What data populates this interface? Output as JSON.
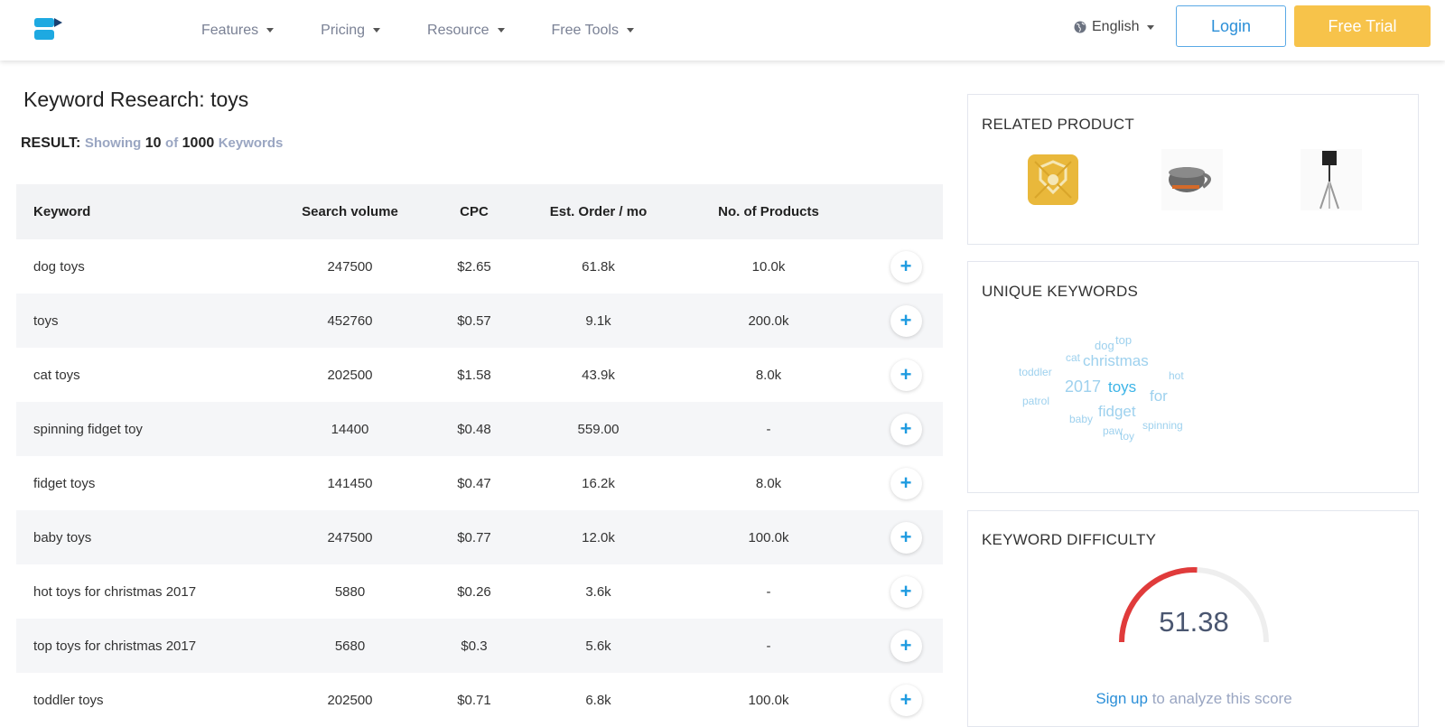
{
  "header": {
    "nav": [
      "Features",
      "Pricing",
      "Resource",
      "Free Tools"
    ],
    "language": "English",
    "login": "Login",
    "free_trial": "Free Trial"
  },
  "page": {
    "title": "Keyword Research: toys",
    "result_label": "RESULT:",
    "showing_text": "Showing",
    "shown_count": "10",
    "of_text": "of",
    "total_count": "1000",
    "keywords_text": "Keywords"
  },
  "table": {
    "headers": [
      "Keyword",
      "Search volume",
      "CPC",
      "Est. Order / mo",
      "No. of Products"
    ],
    "rows": [
      {
        "keyword": "dog toys",
        "volume": "247500",
        "cpc": "$2.65",
        "orders": "61.8k",
        "products": "10.0k"
      },
      {
        "keyword": "toys",
        "volume": "452760",
        "cpc": "$0.57",
        "orders": "9.1k",
        "products": "200.0k"
      },
      {
        "keyword": "cat toys",
        "volume": "202500",
        "cpc": "$1.58",
        "orders": "43.9k",
        "products": "8.0k"
      },
      {
        "keyword": "spinning fidget toy",
        "volume": "14400",
        "cpc": "$0.48",
        "orders": "559.00",
        "products": "-"
      },
      {
        "keyword": "fidget toys",
        "volume": "141450",
        "cpc": "$0.47",
        "orders": "16.2k",
        "products": "8.0k"
      },
      {
        "keyword": "baby toys",
        "volume": "247500",
        "cpc": "$0.77",
        "orders": "12.0k",
        "products": "100.0k"
      },
      {
        "keyword": "hot toys for christmas 2017",
        "volume": "5880",
        "cpc": "$0.26",
        "orders": "3.6k",
        "products": "-"
      },
      {
        "keyword": "top toys for christmas 2017",
        "volume": "5680",
        "cpc": "$0.3",
        "orders": "5.6k",
        "products": "-"
      },
      {
        "keyword": "toddler toys",
        "volume": "202500",
        "cpc": "$0.71",
        "orders": "6.8k",
        "products": "100.0k"
      }
    ],
    "add_symbol": "+"
  },
  "related_product": {
    "title": "RELATED PRODUCT"
  },
  "unique_keywords": {
    "title": "UNIQUE KEYWORDS",
    "words": [
      "dog",
      "top",
      "cat",
      "christmas",
      "toddler",
      "hot",
      "2017",
      "toys",
      "for",
      "patrol",
      "fidget",
      "baby",
      "spinning",
      "paw",
      "toy"
    ]
  },
  "difficulty": {
    "title": "KEYWORD DIFFICULTY",
    "score": "51.38",
    "gauge_fraction": 0.5138,
    "gauge_color": "#e03b3b",
    "signup_link": "Sign up",
    "signup_rest": " to analyze this score"
  },
  "colors": {
    "accent_blue": "#1e9be0",
    "trial_yellow": "#f7c34a",
    "muted_text": "#9aa6c2"
  }
}
